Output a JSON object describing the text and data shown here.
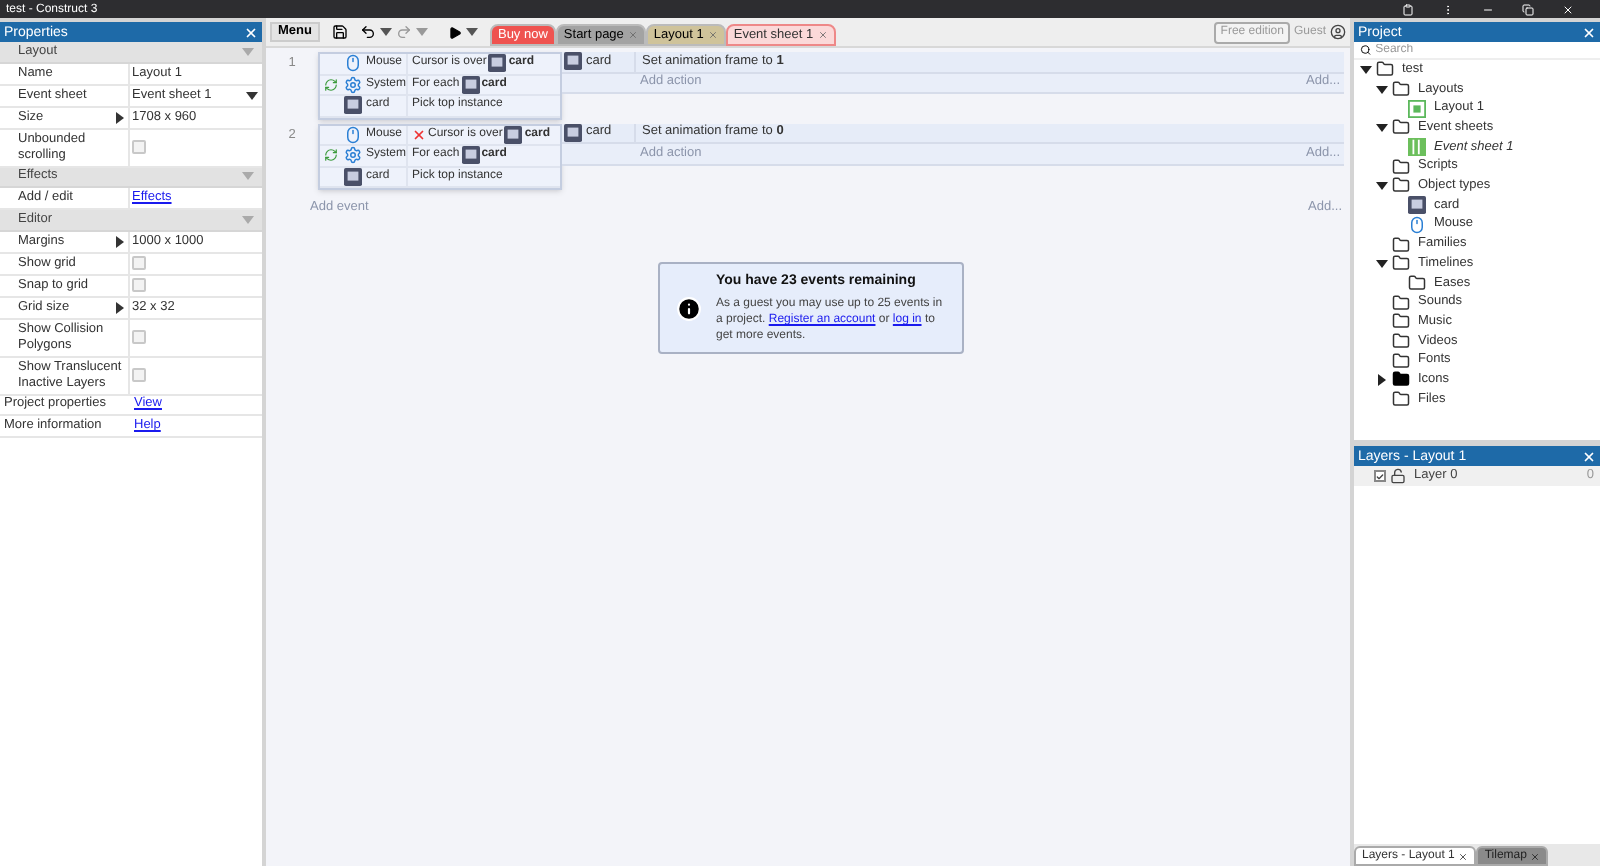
{
  "window": {
    "title": "test - Construct 3"
  },
  "properties": {
    "title": "Properties",
    "sections": [
      {
        "name": "Layout",
        "rows": [
          {
            "kind": "text",
            "label": "Name",
            "value": "Layout 1"
          },
          {
            "kind": "dropdown",
            "label": "Event sheet",
            "value": "Event sheet 1"
          },
          {
            "kind": "expandable",
            "label": "Size",
            "value": "1708 x 960"
          },
          {
            "kind": "checkbox",
            "label": "Unbounded scrolling",
            "checked": false
          }
        ]
      },
      {
        "name": "Effects",
        "rows": [
          {
            "kind": "link",
            "label": "Add / edit",
            "value": "Effects"
          }
        ]
      },
      {
        "name": "Editor",
        "rows": [
          {
            "kind": "expandable",
            "label": "Margins",
            "value": "1000 x 1000"
          },
          {
            "kind": "checkbox",
            "label": "Show grid",
            "checked": false
          },
          {
            "kind": "checkbox",
            "label": "Snap to grid",
            "checked": false
          },
          {
            "kind": "expandable",
            "label": "Grid size",
            "value": "32 x 32"
          },
          {
            "kind": "checkbox",
            "label": "Show Collision Polygons",
            "checked": false
          },
          {
            "kind": "checkbox",
            "label": "Show Translucent Inactive Layers",
            "checked": false
          }
        ]
      }
    ],
    "footer": [
      {
        "label": "Project properties",
        "link": "View"
      },
      {
        "label": "More information",
        "link": "Help"
      }
    ]
  },
  "toolbar": {
    "menu": "Menu",
    "tabs": [
      {
        "label": "Buy now",
        "kind": "promo",
        "color": "#ef5350",
        "selected": false
      },
      {
        "label": "Start page",
        "kind": "page",
        "color": "#a3a3a3",
        "selected": false
      },
      {
        "label": "Layout 1",
        "kind": "page",
        "color": "#cfc39a",
        "selected": false
      },
      {
        "label": "Event sheet 1",
        "kind": "page",
        "color": "#fbd9d9",
        "selected": true
      }
    ],
    "edition": "Free edition",
    "user": "Guest"
  },
  "events": [
    {
      "number": "1",
      "conditions": [
        {
          "object": "Mouse",
          "kind": "mouse",
          "loop": false,
          "inverted": false,
          "text": "Cursor is over",
          "target": "card"
        },
        {
          "object": "System",
          "kind": "system",
          "loop": true,
          "inverted": false,
          "text": "For each",
          "target": "card"
        },
        {
          "object": "card",
          "kind": "card",
          "loop": false,
          "inverted": false,
          "text": "Pick top instance"
        }
      ],
      "actions": [
        {
          "object": "card",
          "text": "Set animation frame to **1**"
        }
      ],
      "add_action": "Add action",
      "add_more": "Add..."
    },
    {
      "number": "2",
      "conditions": [
        {
          "object": "Mouse",
          "kind": "mouse",
          "loop": false,
          "inverted": true,
          "text": "Cursor is over",
          "target": "card"
        },
        {
          "object": "System",
          "kind": "system",
          "loop": true,
          "inverted": false,
          "text": "For each",
          "target": "card"
        },
        {
          "object": "card",
          "kind": "card",
          "loop": false,
          "inverted": false,
          "text": "Pick top instance"
        }
      ],
      "actions": [
        {
          "object": "card",
          "text": "Set animation frame to **0**"
        }
      ],
      "add_action": "Add action",
      "add_more": "Add..."
    }
  ],
  "add_event": "Add event",
  "add_event_more": "Add...",
  "notice": {
    "title": "You have 23 events remaining",
    "text": "As a guest you may use up to 25 events in a project.",
    "link1": "Register an account",
    "middle": "or",
    "link2": "log in",
    "end": "to get more events."
  },
  "project": {
    "title": "Project",
    "search": {
      "placeholder": "Search"
    },
    "tree": [
      {
        "label": "test",
        "kind": "folder",
        "expanded": true,
        "children": [
          {
            "label": "Layouts",
            "kind": "folder",
            "expanded": true,
            "children": [
              {
                "label": "Layout 1",
                "kind": "layout",
                "open": false
              }
            ]
          },
          {
            "label": "Event sheets",
            "kind": "folder",
            "expanded": true,
            "children": [
              {
                "label": "Event sheet 1",
                "kind": "eventsheet",
                "open": true
              }
            ]
          },
          {
            "label": "Scripts",
            "kind": "folder"
          },
          {
            "label": "Object types",
            "kind": "folder",
            "expanded": true,
            "children": [
              {
                "label": "card",
                "kind": "card"
              },
              {
                "label": "Mouse",
                "kind": "mouse"
              }
            ]
          },
          {
            "label": "Families",
            "kind": "folder"
          },
          {
            "label": "Timelines",
            "kind": "folder",
            "expanded": true,
            "children": [
              {
                "label": "Eases",
                "kind": "folder"
              }
            ]
          },
          {
            "label": "Sounds",
            "kind": "folder"
          },
          {
            "label": "Music",
            "kind": "folder"
          },
          {
            "label": "Videos",
            "kind": "folder"
          },
          {
            "label": "Fonts",
            "kind": "folder"
          },
          {
            "label": "Icons",
            "kind": "filledfolder",
            "expanded": false
          },
          {
            "label": "Files",
            "kind": "folder"
          }
        ]
      }
    ]
  },
  "layers": {
    "title": "Layers - Layout 1",
    "rows": [
      {
        "name": "Layer 0",
        "visible": true,
        "locked": false,
        "count": "0"
      }
    ]
  },
  "bottom_tabs": [
    {
      "label": "Layers - Layout 1",
      "selected": true
    },
    {
      "label": "Tilemap",
      "selected": false
    }
  ]
}
